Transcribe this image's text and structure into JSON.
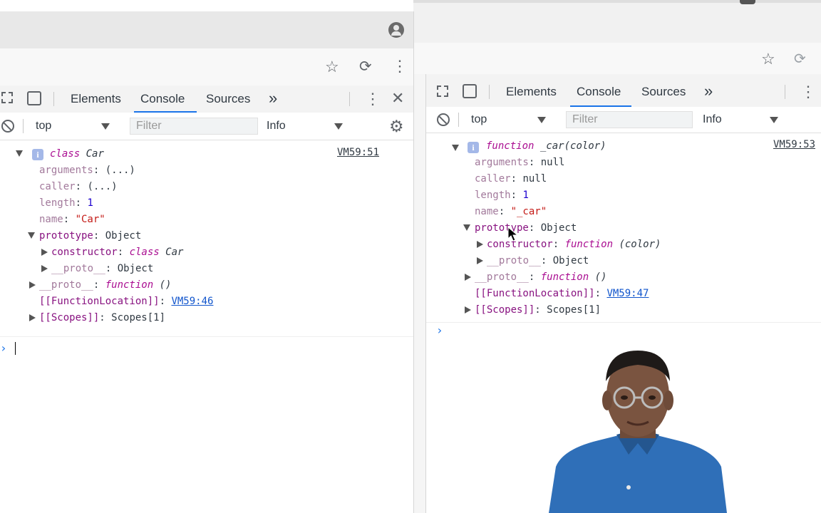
{
  "left": {
    "tabs": [
      "Elements",
      "Console",
      "Sources"
    ],
    "active_tab": "Console",
    "more_tabs": "»",
    "context": "top",
    "filter_placeholder": "Filter",
    "level": "Info",
    "entry": {
      "source": "VM59:51",
      "header_kw": "class",
      "header_name": "Car",
      "props": [
        {
          "key": "arguments",
          "value": "(...)"
        },
        {
          "key": "caller",
          "value": "(...)"
        },
        {
          "key": "length",
          "value": "1"
        },
        {
          "key": "name",
          "value": "\"Car\""
        }
      ],
      "prototype_key": "prototype",
      "prototype_value": "Object",
      "constructor_key": "constructor",
      "constructor_kw": "class",
      "constructor_name": "Car",
      "proto_key": "__proto__",
      "proto_value": "Object",
      "proto2_key": "__proto__",
      "proto2_kw": "function",
      "proto2_rest": "()",
      "funcloc_key": "[[FunctionLocation]]",
      "funcloc_value": "VM59:46",
      "scopes_key": "[[Scopes]]",
      "scopes_value": "Scopes[1]"
    }
  },
  "right": {
    "tabs": [
      "Elements",
      "Console",
      "Sources"
    ],
    "active_tab": "Console",
    "more_tabs": "»",
    "context": "top",
    "filter_placeholder": "Filter",
    "level": "Info",
    "entry": {
      "source": "VM59:53",
      "header_kw": "function",
      "header_name": "_car(color)",
      "props": [
        {
          "key": "arguments",
          "value": "null"
        },
        {
          "key": "caller",
          "value": "null"
        },
        {
          "key": "length",
          "value": "1"
        },
        {
          "key": "name",
          "value": "\"_car\""
        }
      ],
      "prototype_key": "prototype",
      "prototype_value": "Object",
      "constructor_key": "constructor",
      "constructor_kw": "function",
      "constructor_rest": "(color)",
      "proto_key": "__proto__",
      "proto_value": "Object",
      "proto2_key": "__proto__",
      "proto2_kw": "function",
      "proto2_rest": "()",
      "funcloc_key": "[[FunctionLocation]]",
      "funcloc_value": "VM59:47",
      "scopes_key": "[[Scopes]]",
      "scopes_value": "Scopes[1]"
    }
  },
  "icons": [
    "profile-icon",
    "star-icon",
    "extension-icon",
    "menu-dots-icon",
    "inspect-icon",
    "device-toggle-icon",
    "close-icon",
    "clear-console-icon",
    "settings-gear-icon",
    "mouse-cursor-icon"
  ],
  "colors": {
    "accent": "#1a73e8",
    "property": "#881280",
    "number": "#1c00cf",
    "string": "#c41a16",
    "keyword": "#aa0d91"
  }
}
